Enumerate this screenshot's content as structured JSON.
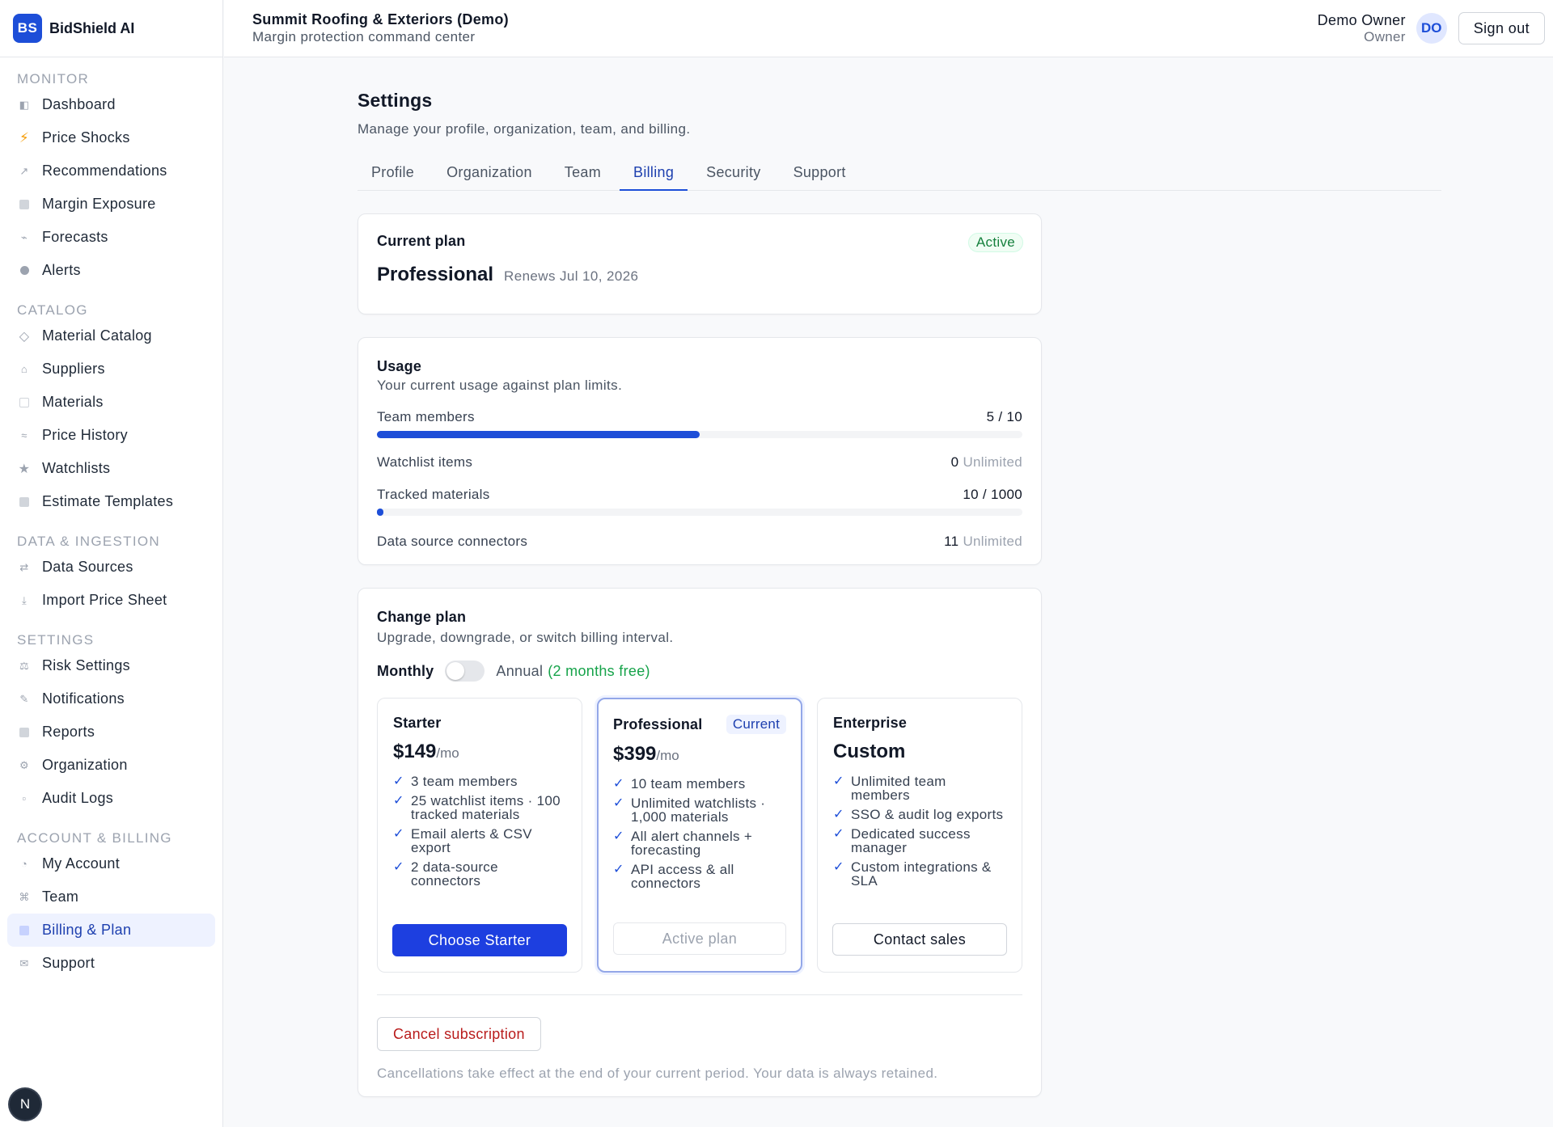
{
  "brand": {
    "logo": "BS",
    "name": "BidShield AI",
    "color": "#1d4ed8"
  },
  "header": {
    "org_name": "Summit Roofing & Exteriors (Demo)",
    "org_sub": "Margin protection command center",
    "user_name": "Demo Owner",
    "user_role": "Owner",
    "avatar": "DO",
    "signout": "Sign out"
  },
  "sidebar": {
    "sections": [
      {
        "title": "MONITOR",
        "items": [
          {
            "label": "Dashboard",
            "icon": "dashboard-icon"
          },
          {
            "label": "Price Shocks",
            "icon": "lightning-icon"
          },
          {
            "label": "Recommendations",
            "icon": "arrow-up-right-icon"
          },
          {
            "label": "Margin Exposure",
            "icon": "square-icon"
          },
          {
            "label": "Forecasts",
            "icon": "trend-icon"
          },
          {
            "label": "Alerts",
            "icon": "alert-dot-icon"
          }
        ]
      },
      {
        "title": "CATALOG",
        "items": [
          {
            "label": "Material Catalog",
            "icon": "diamond-icon"
          },
          {
            "label": "Suppliers",
            "icon": "home-icon"
          },
          {
            "label": "Materials",
            "icon": "box-icon"
          },
          {
            "label": "Price History",
            "icon": "approx-icon"
          },
          {
            "label": "Watchlists",
            "icon": "star-icon"
          },
          {
            "label": "Estimate Templates",
            "icon": "template-icon"
          }
        ]
      },
      {
        "title": "DATA & INGESTION",
        "items": [
          {
            "label": "Data Sources",
            "icon": "swap-icon"
          },
          {
            "label": "Import Price Sheet",
            "icon": "download-icon"
          }
        ]
      },
      {
        "title": "SETTINGS",
        "items": [
          {
            "label": "Risk Settings",
            "icon": "scale-icon"
          },
          {
            "label": "Notifications",
            "icon": "pen-icon"
          },
          {
            "label": "Reports",
            "icon": "report-icon"
          },
          {
            "label": "Organization",
            "icon": "gear-icon"
          },
          {
            "label": "Audit Logs",
            "icon": "log-icon"
          }
        ]
      },
      {
        "title": "ACCOUNT & BILLING",
        "items": [
          {
            "label": "My Account",
            "icon": "user-icon"
          },
          {
            "label": "Team",
            "icon": "command-icon"
          },
          {
            "label": "Billing & Plan",
            "icon": "billing-icon",
            "active": true
          },
          {
            "label": "Support",
            "icon": "mail-icon"
          }
        ]
      }
    ]
  },
  "page": {
    "title": "Settings",
    "subtitle": "Manage your profile, organization, team, and billing.",
    "tabs": [
      {
        "label": "Profile"
      },
      {
        "label": "Organization"
      },
      {
        "label": "Team"
      },
      {
        "label": "Billing",
        "active": true
      },
      {
        "label": "Security"
      },
      {
        "label": "Support"
      }
    ]
  },
  "current_plan": {
    "label": "Current plan",
    "status": "Active",
    "name": "Professional",
    "renews": "Renews Jul 10, 2026"
  },
  "usage": {
    "title": "Usage",
    "desc": "Your current usage against plan limits.",
    "rows": [
      {
        "label": "Team members",
        "value": "5 / 10",
        "progress": 0.5
      },
      {
        "label": "Watchlist items",
        "value": "0",
        "suffix": "Unlimited"
      },
      {
        "label": "Tracked materials",
        "value": "10 / 1000",
        "progress": 0.01
      },
      {
        "label": "Data source connectors",
        "value": "11",
        "suffix": "Unlimited"
      }
    ]
  },
  "change_plan": {
    "title": "Change plan",
    "desc": "Upgrade, downgrade, or switch billing interval.",
    "monthly": "Monthly",
    "annual": "Annual",
    "annual_note": "(2 months free)",
    "annual_on": false,
    "plans": [
      {
        "name": "Starter",
        "price": "$149",
        "per": "/mo",
        "features": [
          "3 team members",
          "25 watchlist items · 100 tracked materials",
          "Email alerts & CSV export",
          "2 data-source connectors"
        ],
        "button": "Choose Starter"
      },
      {
        "name": "Professional",
        "badge": "Current",
        "price": "$399",
        "per": "/mo",
        "features": [
          "10 team members",
          "Unlimited watchlists · 1,000 materials",
          "All alert channels + forecasting",
          "API access & all connectors"
        ],
        "button": "Active plan"
      },
      {
        "name": "Enterprise",
        "price": "Custom",
        "features": [
          "Unlimited team members",
          "SSO & audit log exports",
          "Dedicated success manager",
          "Custom integrations & SLA"
        ],
        "button": "Contact sales"
      }
    ],
    "cancel_button": "Cancel subscription",
    "cancel_note": "Cancellations take effect at the end of your current period. Your data is always retained."
  },
  "dev_badge": "N"
}
